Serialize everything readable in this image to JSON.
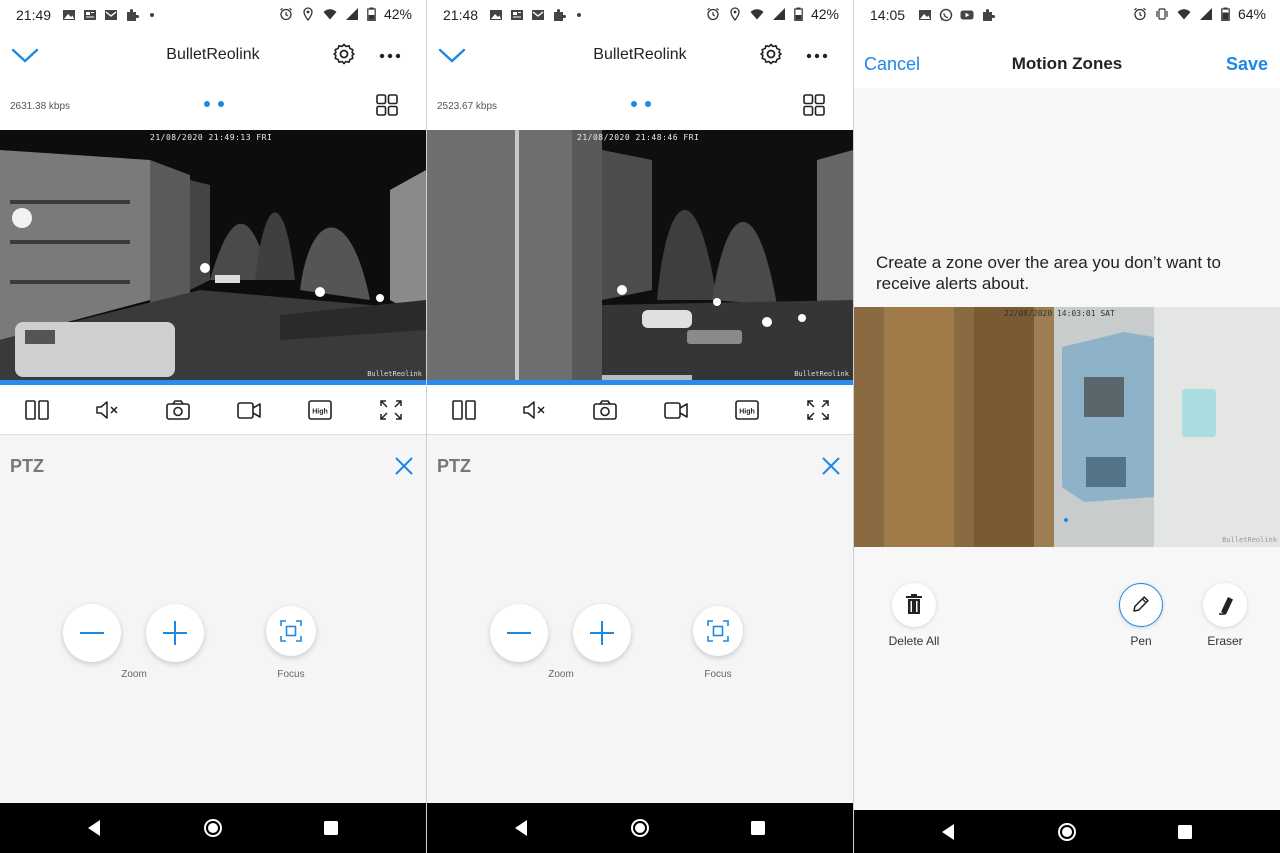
{
  "panels": [
    {
      "status": {
        "time": "21:49",
        "battery": "42%"
      },
      "header": {
        "title": "BulletReolink"
      },
      "info": {
        "bitrate": "2631.38 kbps"
      },
      "video": {
        "timestamp": "21/08/2020 21:49:13 FRI",
        "camera_name": "BulletReolink"
      },
      "ptz": {
        "title": "PTZ",
        "zoom_label": "Zoom",
        "focus_label": "Focus"
      }
    },
    {
      "status": {
        "time": "21:48",
        "battery": "42%"
      },
      "header": {
        "title": "BulletReolink"
      },
      "info": {
        "bitrate": "2523.67 kbps"
      },
      "video": {
        "timestamp": "21/08/2020 21:48:46 FRI",
        "camera_name": "BulletReolink"
      },
      "ptz": {
        "title": "PTZ",
        "zoom_label": "Zoom",
        "focus_label": "Focus"
      }
    }
  ],
  "motion": {
    "status": {
      "time": "14:05",
      "battery": "64%"
    },
    "header": {
      "cancel_label": "Cancel",
      "title": "Motion Zones",
      "save_label": "Save"
    },
    "description": "Create a zone over the area you don’t want to receive alerts about.",
    "video": {
      "timestamp": "22/08/2020 14:03:01 SAT",
      "camera_name": "BulletReolink"
    },
    "tools": {
      "delete_label": "Delete All",
      "pen_label": "Pen",
      "eraser_label": "Eraser"
    }
  },
  "icons": {
    "back": "chevron-down-icon",
    "settings": "gear-icon",
    "more": "more-dots-icon",
    "layout": "grid-icon",
    "split": "split-view-icon",
    "mute": "speaker-muted-icon",
    "snapshot": "camera-icon",
    "record": "video-record-icon",
    "quality": "hd-quality-icon",
    "fullscreen": "fullscreen-icon"
  },
  "colors": {
    "accent": "#1e88e5",
    "progress": "#2b8bea",
    "navbar": "#000000"
  }
}
